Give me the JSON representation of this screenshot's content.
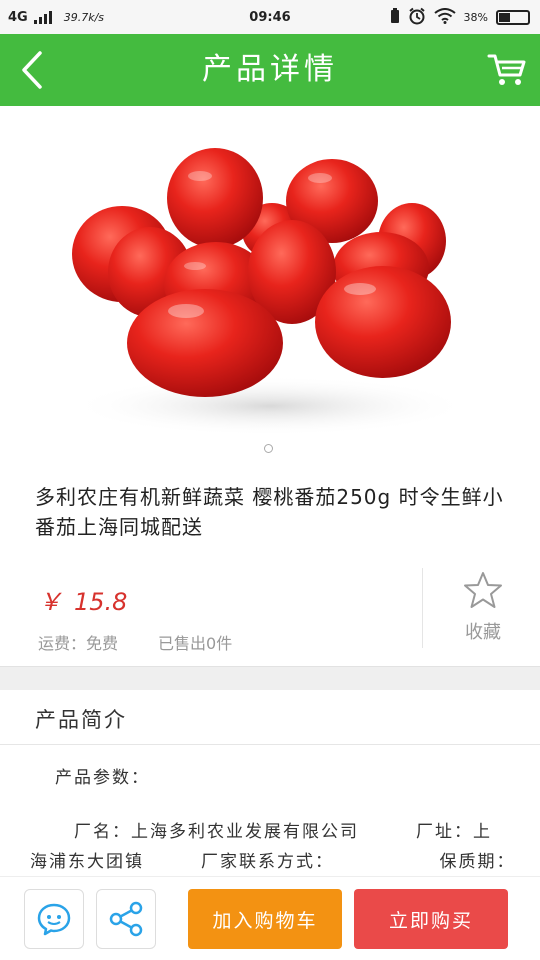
{
  "status_bar": {
    "network": "4G",
    "speed": "39.7k/s",
    "time": "09:46",
    "battery": "38",
    "battery_level": 0.38
  },
  "nav": {
    "title": "产品详情",
    "back_icon": "chevron-left-icon",
    "cart_icon": "cart-icon"
  },
  "product": {
    "image_icon": "cherry-tomatoes-image",
    "title": "多利农庄有机新鲜蔬菜 樱桃番茄250g 时令生鲜小番茄上海同城配送",
    "currency": "￥",
    "price": "15.8",
    "shipping": "运费：免费",
    "sold": "已售出0件",
    "favorite_label": "收藏",
    "favorite_icon": "star-icon"
  },
  "intro": {
    "title": "产品简介",
    "params_label": "产品参数：",
    "body": "厂名：上海多利农业发展有限公司　　　厂址：上海浦东大团镇　　　厂家联系方式：　　　　　　保质期：　　天　　食品添加剂：无"
  },
  "bottom_bar": {
    "chat_icon": "chat-bubble-icon",
    "share_icon": "share-icon",
    "add_to_cart": "加入购物车",
    "buy_now": "立即购买"
  },
  "colors": {
    "nav_green": "#44bb3f",
    "price_red": "#d7322d",
    "cart_orange": "#f39212",
    "buy_red": "#ea4a49"
  }
}
